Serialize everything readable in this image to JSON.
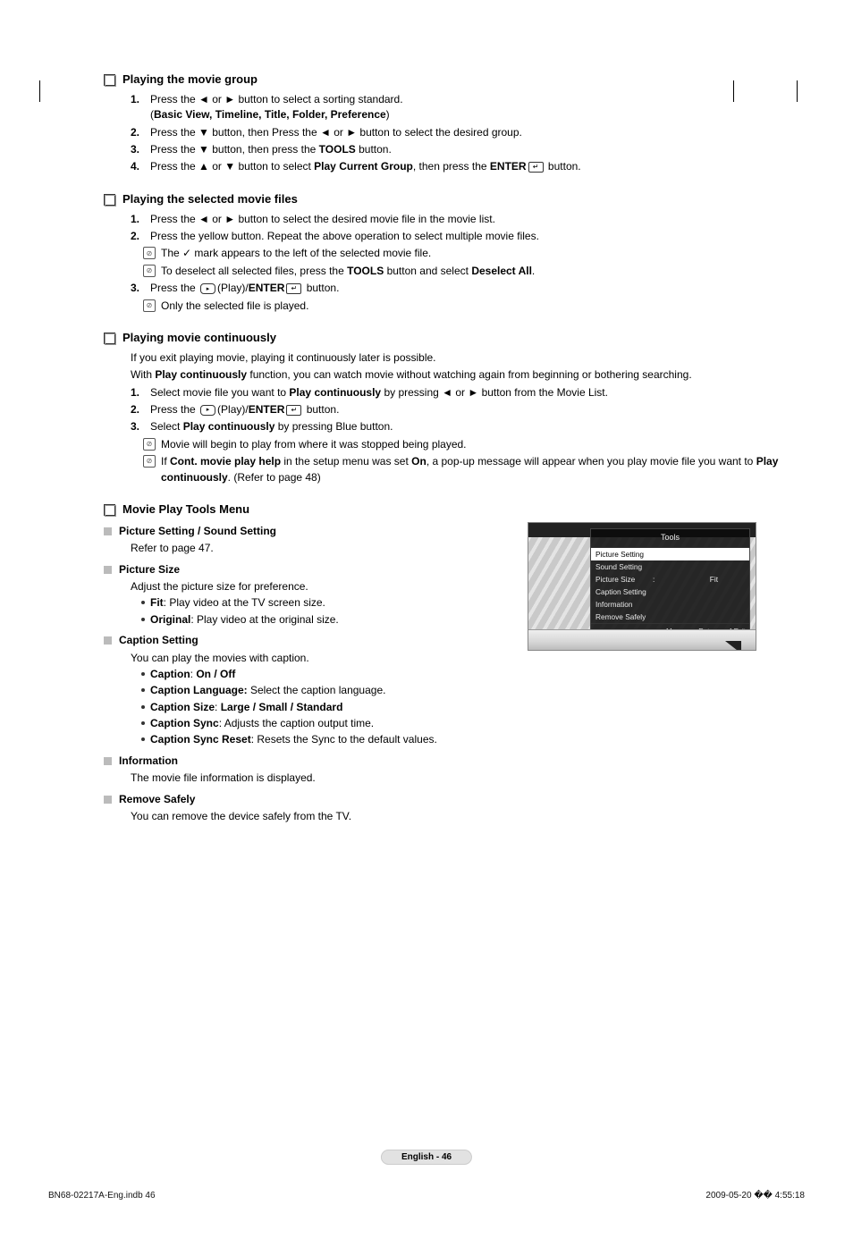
{
  "sections": {
    "s1": {
      "title": "Playing the movie group",
      "steps": {
        "n1_a": "Press the ◄ or ► button to select a sorting standard.",
        "n1_b_pre": "(",
        "n1_b_bold": "Basic View, Timeline, Title, Folder, Preference",
        "n1_b_suf": ")",
        "n2": "Press the ▼ button, then Press the ◄ or ► button to select the desired group.",
        "n3_a": " Press the ▼ button, then press the ",
        "n3_b": "TOOLS",
        "n3_c": " button.",
        "n4_a": "Press the ▲ or ▼ button to select ",
        "n4_b": "Play Current Group",
        "n4_c": ", then press the ",
        "n4_d": "ENTER",
        "n4_e": " button."
      }
    },
    "s2": {
      "title": "Playing the selected movie files",
      "steps": {
        "n1": "Press the ◄ or ► button to select the desired movie file in the movie list.",
        "n2": "Press the yellow button. Repeat the above operation to select multiple movie files.",
        "n2_note1_a": "The ",
        "n2_note1_check": "✓",
        "n2_note1_b": " mark appears to the left of the selected movie file.",
        "n2_note2_a": "To deselect all selected files, press the ",
        "n2_note2_b": "TOOLS",
        "n2_note2_c": " button and select ",
        "n2_note2_d": "Deselect All",
        "n2_note2_e": ".",
        "n3_a": "Press the ",
        "n3_b": "(Play)/",
        "n3_c": "ENTER",
        "n3_d": " button.",
        "n3_note": "Only the selected file is played."
      }
    },
    "s3": {
      "title": "Playing movie continuously",
      "intro1": "If you exit playing movie, playing it continuously later is possible.",
      "intro2_a": "With ",
      "intro2_b": "Play continuously",
      "intro2_c": " function, you can watch movie without watching again from beginning or bothering searching.",
      "steps": {
        "n1_a": "Select movie file you want to ",
        "n1_b": "Play continuously",
        "n1_c": " by pressing ◄ or ► button from the Movie List.",
        "n2_a": "Press the ",
        "n2_b": "(Play)/",
        "n2_c": "ENTER",
        "n2_d": " button.",
        "n3_a": "Select ",
        "n3_b": "Play continuously",
        "n3_c": " by pressing Blue button.",
        "n3_note1": "Movie will begin to play from where it was stopped being played.",
        "n3_note2_a": "If ",
        "n3_note2_b": "Cont. movie play help",
        "n3_note2_c": " in the setup menu was set ",
        "n3_note2_d": "On",
        "n3_note2_e": ", a pop-up message will appear when you play movie file you want to ",
        "n3_note2_f": "Play continuously",
        "n3_note2_g": ". (Refer to page 48)"
      }
    },
    "s4": {
      "title": "Movie Play Tools Menu",
      "items": {
        "i1_title": "Picture Setting / Sound Setting",
        "i1_body": "Refer to page 47.",
        "i2_title": "Picture Size",
        "i2_body": "Adjust the picture size for preference.",
        "i2_b1_k": "Fit",
        "i2_b1_v": ": Play video at the TV screen size.",
        "i2_b2_k": "Original",
        "i2_b2_v": ": Play video at the original size.",
        "i3_title": "Caption Setting",
        "i3_body": "You can play the movies with caption.",
        "i3_b1_k": "Caption",
        "i3_b1_v": ": ",
        "i3_b1_v2": "On / Off",
        "i3_b2_k": "Caption Language:",
        "i3_b2_v": " Select the caption language.",
        "i3_b3_k": "Caption Size",
        "i3_b3_v": ": ",
        "i3_b3_v2": "Large / Small / Standard",
        "i3_b4_k": "Caption Sync",
        "i3_b4_v": ": Adjusts the caption output time.",
        "i3_b5_k": "Caption Sync Reset",
        "i3_b5_v": ": Resets the Sync to the default values.",
        "i4_title": "Information",
        "i4_body": "The movie file information is displayed.",
        "i5_title": "Remove Safely",
        "i5_body": "You can remove the device safely from the TV."
      }
    }
  },
  "tools_fig": {
    "title": "Tools",
    "rows": [
      {
        "label": "Picture Setting"
      },
      {
        "label": "Sound Setting"
      },
      {
        "label": "Picture Size",
        "val": "Fit"
      },
      {
        "label": "Caption Setting"
      },
      {
        "label": "Information"
      },
      {
        "label": "Remove Safely"
      }
    ],
    "foot_move": "Move",
    "foot_enter": "Enter",
    "foot_exit": "Exit"
  },
  "page_label": "English - 46",
  "footer_left": "BN68-02217A-Eng.indb   46",
  "footer_right": "2009-05-20   �� 4:55:18"
}
